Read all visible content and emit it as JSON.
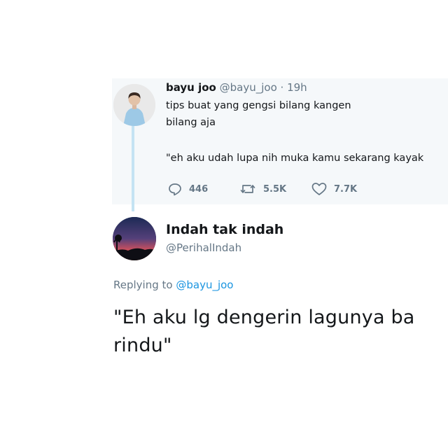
{
  "parent_tweet": {
    "display_name": "bayu joo",
    "handle": "@bayu_joo",
    "separator": "·",
    "time": "19h",
    "lines": [
      "tips buat yang gengsi bilang kangen",
      "bilang aja",
      "\"eh aku udah lupa nih muka kamu sekarang kayak"
    ],
    "actions": {
      "replies": "446",
      "retweets": "5.5K",
      "likes": "7.7K"
    }
  },
  "reply_tweet": {
    "display_name": "Indah tak indah",
    "handle": "@PerihalIndah",
    "replying_prefix": "Replying to",
    "replying_to": "@bayu_joo",
    "text_lines": [
      "\"Eh aku lg dengerin lagunya ba",
      "rindu\""
    ]
  },
  "colors": {
    "parent_background": "#f5f8fa",
    "thread_line": "#c4e3f3",
    "link": "#1b95e0",
    "secondary_text": "#657786"
  },
  "icons": [
    "reply-icon",
    "retweet-icon",
    "like-icon"
  ]
}
